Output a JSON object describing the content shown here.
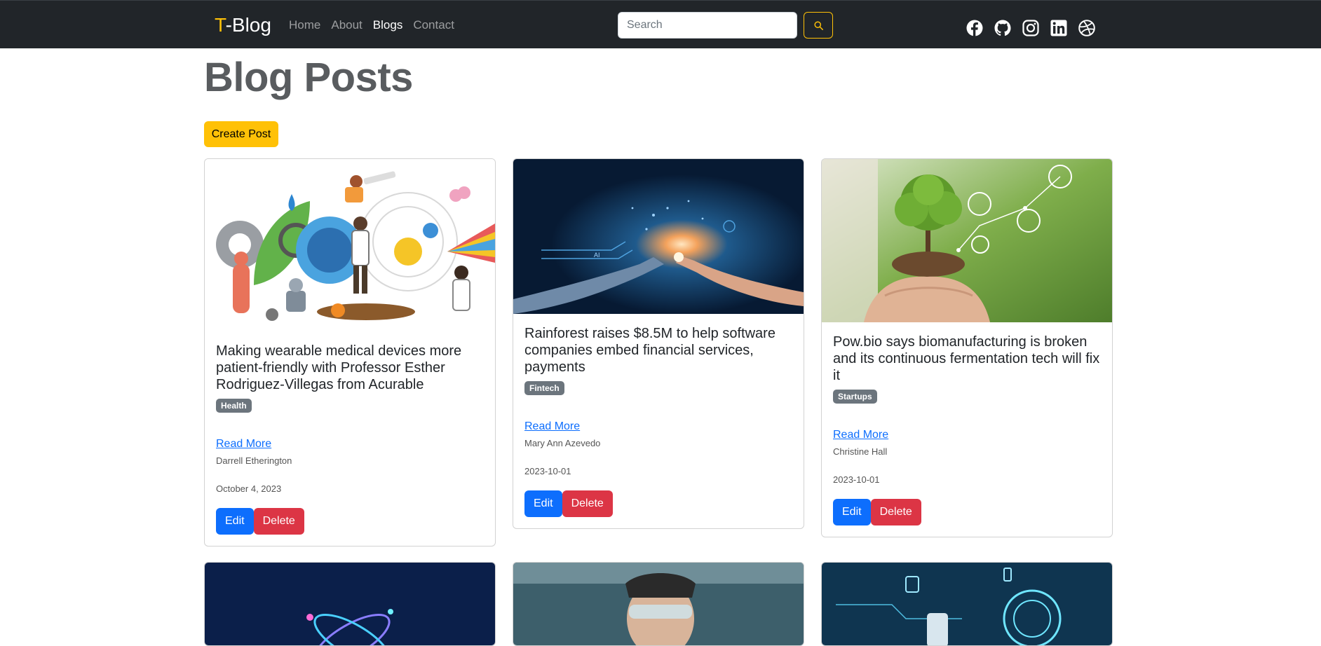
{
  "brand": {
    "prefix": "T",
    "suffix": "-Blog"
  },
  "nav": {
    "links": [
      "Home",
      "About",
      "Blogs",
      "Contact"
    ],
    "active": "Blogs"
  },
  "search": {
    "placeholder": "Search",
    "value": ""
  },
  "socials": [
    "facebook-icon",
    "github-icon",
    "instagram-icon",
    "linkedin-icon",
    "dribbble-icon"
  ],
  "page": {
    "title": "Blog Posts",
    "create_label": "Create Post"
  },
  "posts": [
    {
      "title": "Making wearable medical devices more patient-friendly with Professor Esther Rodriguez-Villegas from Acurable",
      "category": "Health",
      "read_more": "Read More",
      "author": "Darrell Etherington",
      "date": "October 4, 2023",
      "edit": "Edit",
      "delete": "Delete"
    },
    {
      "title": "Rainforest raises $8.5M to help software companies embed financial services, payments",
      "category": "Fintech",
      "read_more": "Read More",
      "author": "Mary Ann Azevedo",
      "date": "2023-10-01",
      "edit": "Edit",
      "delete": "Delete"
    },
    {
      "title": "Pow.bio says biomanufacturing is broken and its continuous fermentation tech will fix it",
      "category": "Startups",
      "read_more": "Read More",
      "author": "Christine Hall",
      "date": "2023-10-01",
      "edit": "Edit",
      "delete": "Delete"
    }
  ],
  "colors": {
    "navbar": "#212529",
    "brand_accent": "#ffc107",
    "primary": "#0d6efd",
    "danger": "#dc3545",
    "badge": "#6c757d"
  }
}
